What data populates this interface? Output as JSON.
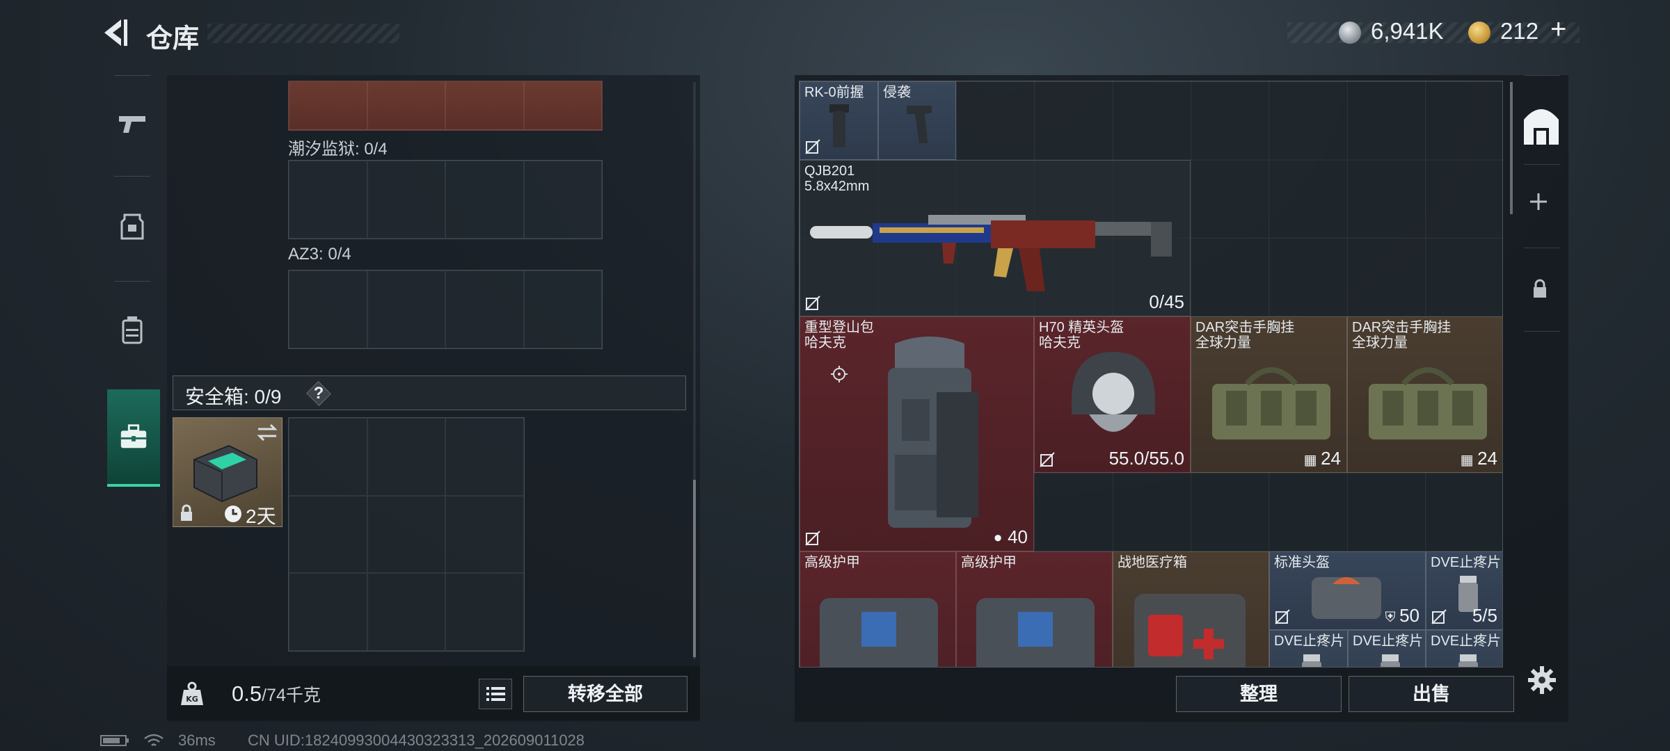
{
  "header": {
    "title": "仓库",
    "currency": [
      {
        "icon": "silver-coin-icon",
        "value": "6,941K"
      },
      {
        "icon": "gold-coin-icon",
        "value": "212"
      }
    ],
    "plus": "+"
  },
  "left_nav": [
    {
      "icon": "pistol-icon",
      "active": false
    },
    {
      "icon": "armor-vest-icon",
      "active": false
    },
    {
      "icon": "backpack-icon",
      "active": false
    },
    {
      "icon": "briefcase-icon",
      "active": true
    }
  ],
  "left_panel": {
    "sections": [
      {
        "label": "潮汐监狱: 0/4"
      },
      {
        "label": "AZ3: 0/4"
      }
    ],
    "safe_box": {
      "label": "安全箱: 0/9",
      "help": "?",
      "duration": "2天"
    }
  },
  "bottom_left": {
    "weight_value": "0.5",
    "weight_max": "/74千克",
    "transfer_label": "转移全部"
  },
  "status": {
    "ping": "36ms",
    "uid": "CN UID:18240993004430323313_202609011028"
  },
  "right_items": [
    {
      "name": "RK-0前握",
      "count": ""
    },
    {
      "name": "侵袭",
      "count": ""
    },
    {
      "name": "QJB201\n5.8x42mm",
      "count": "0/45"
    },
    {
      "name": "重型登山包\n哈夫克",
      "count": "40"
    },
    {
      "name": "H70 精英头盔\n哈夫克",
      "count": "55.0/55.0"
    },
    {
      "name": "DAR突击手胸挂\n全球力量",
      "count": "24"
    },
    {
      "name": "DAR突击手胸挂\n全球力量",
      "count": "24"
    },
    {
      "name": "高级护甲",
      "count": ""
    },
    {
      "name": "高级护甲",
      "count": ""
    },
    {
      "name": "战地医疗箱",
      "count": ""
    },
    {
      "name": "标准头盔",
      "count": "50"
    },
    {
      "name": "DVE止疼片",
      "count": "5/5"
    },
    {
      "name": "DVE止疼片",
      "count": ""
    },
    {
      "name": "DVE止疼片",
      "count": ""
    },
    {
      "name": "DVE止疼片",
      "count": ""
    }
  ],
  "bottom_right": {
    "sort_label": "整理",
    "sell_label": "出售"
  },
  "colors": {
    "accent": "#3bd2a6",
    "red_rarity": "#5a252b",
    "gold_rarity": "#4a3d30",
    "blue_rarity": "#38465a"
  }
}
